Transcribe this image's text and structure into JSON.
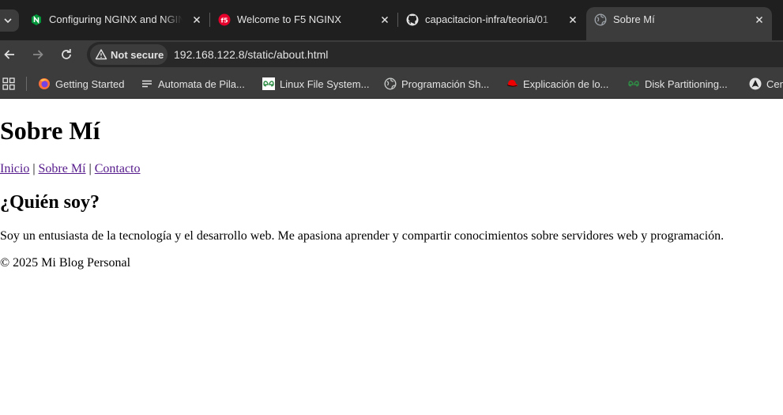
{
  "browser": {
    "tabs": [
      {
        "title": "Configuring NGINX and NGINX Plus",
        "favicon": "nginx-icon"
      },
      {
        "title": "Welcome to F5 NGINX",
        "favicon": "f5-icon"
      },
      {
        "title": "capacitacion-infra/teoria/01",
        "favicon": "github-icon"
      },
      {
        "title": "Sobre Mí",
        "favicon": "globe-icon",
        "active": true
      }
    ],
    "security_label": "Not secure",
    "url": "192.168.122.8/static/about.html",
    "bookmarks": [
      {
        "label": "Getting Started",
        "icon": "firefox-icon"
      },
      {
        "label": "Automata de Pila...",
        "icon": "lines-icon"
      },
      {
        "label": "Linux File System...",
        "icon": "geeksforgeeks-icon"
      },
      {
        "label": "Programación Sh...",
        "icon": "globe-icon"
      },
      {
        "label": "Explicación de lo...",
        "icon": "redhat-icon"
      },
      {
        "label": "Disk Partitioning...",
        "icon": "geeksforgeeks-icon"
      },
      {
        "label": "Cen",
        "icon": "arch-icon"
      }
    ],
    "colors": {
      "tabstrip": "#1f1f1f",
      "toolbar": "#3c3c3c",
      "omnibox": "#282828",
      "text": "#e3e3e3"
    }
  },
  "page": {
    "title": "Sobre Mí",
    "nav": {
      "home": "Inicio",
      "separator": " | ",
      "about": "Sobre Mí",
      "contact": "Contacto"
    },
    "heading": "¿Quién soy?",
    "paragraph": "Soy un entusiasta de la tecnología y el desarrollo web. Me apasiona aprender y compartir conocimientos sobre servidores web y programación.",
    "footer": "© 2025 Mi Blog Personal",
    "colors": {
      "link": "#551a8b"
    }
  }
}
